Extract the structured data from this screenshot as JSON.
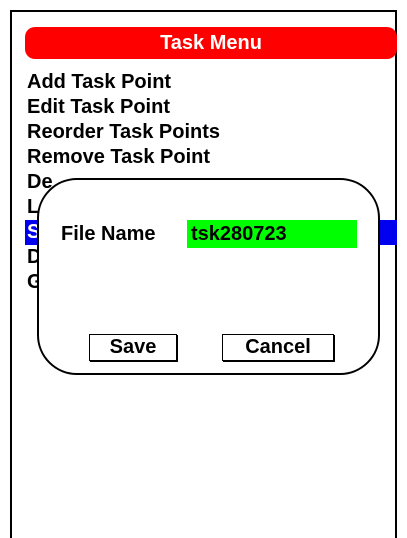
{
  "header": {
    "title": "Task Menu"
  },
  "menu": {
    "items": [
      {
        "label": "Add Task Point",
        "selected": false
      },
      {
        "label": "Edit Task Point",
        "selected": false
      },
      {
        "label": "Reorder Task Points",
        "selected": false
      },
      {
        "label": "Remove Task Point",
        "selected": false
      },
      {
        "label": "De",
        "selected": false
      },
      {
        "label": "Lo",
        "selected": false
      },
      {
        "label": "Sa",
        "selected": true
      },
      {
        "label": "D",
        "selected": false
      },
      {
        "label": "G",
        "selected": false
      }
    ]
  },
  "dialog": {
    "field_label": "File Name",
    "file_name_value": "tsk280723",
    "save_label": "Save",
    "cancel_label": "Cancel"
  },
  "colors": {
    "title_bar": "#ff0000",
    "selection": "#0000ee",
    "input_background": "#00ff00"
  }
}
